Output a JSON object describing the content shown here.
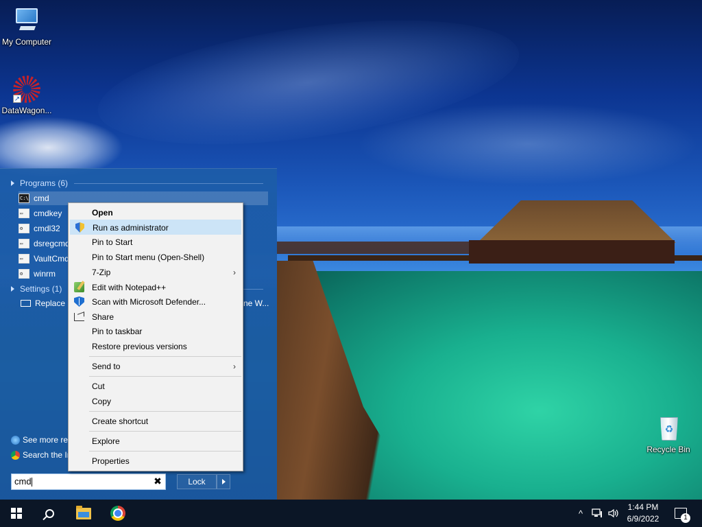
{
  "desktop": {
    "icons": [
      {
        "label": "My Computer",
        "icon": "computer-icon"
      },
      {
        "label": "DataWagon...",
        "icon": "datawagon-shortcut-icon"
      },
      {
        "label": "Recycle Bin",
        "icon": "recycle-bin-icon"
      }
    ]
  },
  "start_menu": {
    "groups": {
      "programs": "Programs (6)",
      "settings": "Settings (1)"
    },
    "programs": [
      {
        "label": "cmd",
        "icon": "cmd-icon"
      },
      {
        "label": "cmdkey",
        "icon": "cmd-icon"
      },
      {
        "label": "cmdl32",
        "icon": "cmdl32-icon"
      },
      {
        "label": "dsregcmd",
        "icon": "cmd-icon"
      },
      {
        "label": "VaultCmd",
        "icon": "cmd-icon"
      },
      {
        "label": "winrm",
        "icon": "script-icon"
      }
    ],
    "settings_item": {
      "label": "Replace Command Prompt with Windows PowerShell...",
      "visible_left": "Replace C",
      "visible_right": "ne W..."
    },
    "see_more": "See more results",
    "search_internet": "Search the Internet",
    "search_value": "cmd",
    "clear_label": "✖",
    "lock_label": "Lock"
  },
  "context_menu": {
    "items": [
      {
        "label": "Open",
        "bold": true
      },
      {
        "label": "Run as administrator",
        "icon": "uac-shield-icon",
        "highlighted": true
      },
      {
        "label": "Pin to Start"
      },
      {
        "label": "Pin to Start menu (Open-Shell)"
      },
      {
        "label": "7-Zip",
        "submenu": true
      },
      {
        "label": "Edit with Notepad++",
        "icon": "notepadpp-icon"
      },
      {
        "label": "Scan with Microsoft Defender...",
        "icon": "defender-icon"
      },
      {
        "label": "Share",
        "icon": "share-icon"
      },
      {
        "label": "Pin to taskbar"
      },
      {
        "label": "Restore previous versions"
      },
      {
        "label": "Send to",
        "submenu": true
      },
      {
        "label": "Cut"
      },
      {
        "label": "Copy"
      },
      {
        "label": "Create shortcut"
      },
      {
        "label": "Explore"
      },
      {
        "label": "Properties"
      }
    ],
    "submenu_glyph": "›"
  },
  "taskbar": {
    "clock_time": "1:44 PM",
    "clock_date": "6/9/2022",
    "notification_count": "1",
    "tray_chevron": "^"
  },
  "colors": {
    "start_menu_bg": "#1c5ca8",
    "highlight": "#cce4f7",
    "taskbar_bg": "#0b1626"
  }
}
